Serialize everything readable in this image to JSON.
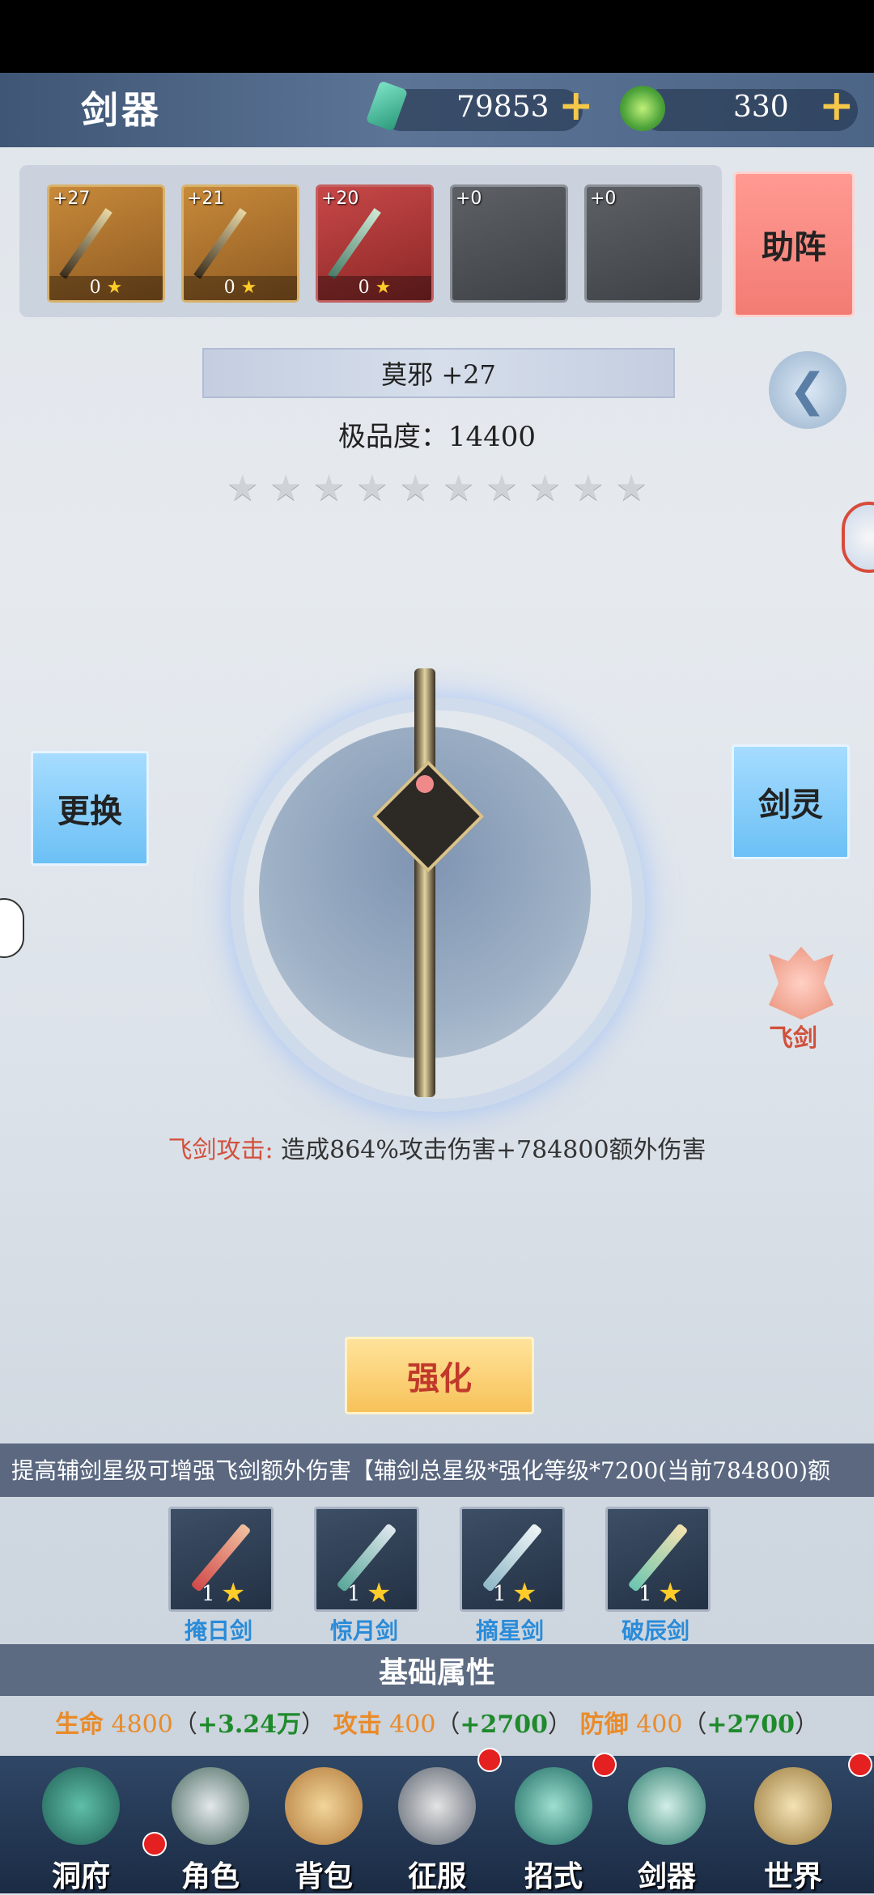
{
  "header": {
    "title": "剑器"
  },
  "resources": {
    "crystal": {
      "value": "79853",
      "plus": "+"
    },
    "jade": {
      "value": "330",
      "plus": "+"
    }
  },
  "slots": [
    {
      "level": "+27",
      "stars": "0",
      "star_icon": "★"
    },
    {
      "level": "+21",
      "stars": "0",
      "star_icon": "★"
    },
    {
      "level": "+20",
      "stars": "0",
      "star_icon": "★"
    },
    {
      "level": "+0"
    },
    {
      "level": "+0"
    }
  ],
  "assist_button": "助阵",
  "weapon": {
    "name": "莫邪 +27",
    "quality": "极品度：14400",
    "star_count": 0,
    "star_total": 10
  },
  "star_glyph": "★",
  "change_button": "更换",
  "spirit_button": "剑灵",
  "flying_sword_label": "飞剑",
  "attack": {
    "label": "飞剑攻击:",
    "text": "造成864%攻击伤害+784800额外伤害"
  },
  "enhance_button": "强化",
  "info_text": "提高辅剑星级可增强飞剑额外伤害【辅剑总星级*强化等级*7200(当前784800)额",
  "aux_swords": [
    {
      "name": "掩日剑",
      "level": "1",
      "star": "★"
    },
    {
      "name": "惊月剑",
      "level": "1",
      "star": "★"
    },
    {
      "name": "摘星剑",
      "level": "1",
      "star": "★"
    },
    {
      "name": "破辰剑",
      "level": "1",
      "star": "★"
    }
  ],
  "basic_attributes": {
    "title": "基础属性",
    "hp": {
      "name": "生命",
      "base": "4800",
      "bonus": "+3.24万"
    },
    "atk": {
      "name": "攻击",
      "base": "400",
      "bonus": "+2700"
    },
    "def": {
      "name": "防御",
      "base": "400",
      "bonus": "+2700"
    },
    "open_paren": "（",
    "close_paren": "）"
  },
  "nav": [
    {
      "label": "洞府",
      "badge": true
    },
    {
      "label": "角色",
      "badge": false
    },
    {
      "label": "背包",
      "badge": false
    },
    {
      "label": "征服",
      "badge": true
    },
    {
      "label": "招式",
      "badge": true
    },
    {
      "label": "剑器",
      "badge": false
    },
    {
      "label": "世界",
      "badge": true
    }
  ],
  "colors": {
    "accent_red": "#d2513c",
    "aux_name_blue": "#2a8bd8",
    "stat_orange": "#e98b2a",
    "bonus_green": "#1f8a2c"
  }
}
